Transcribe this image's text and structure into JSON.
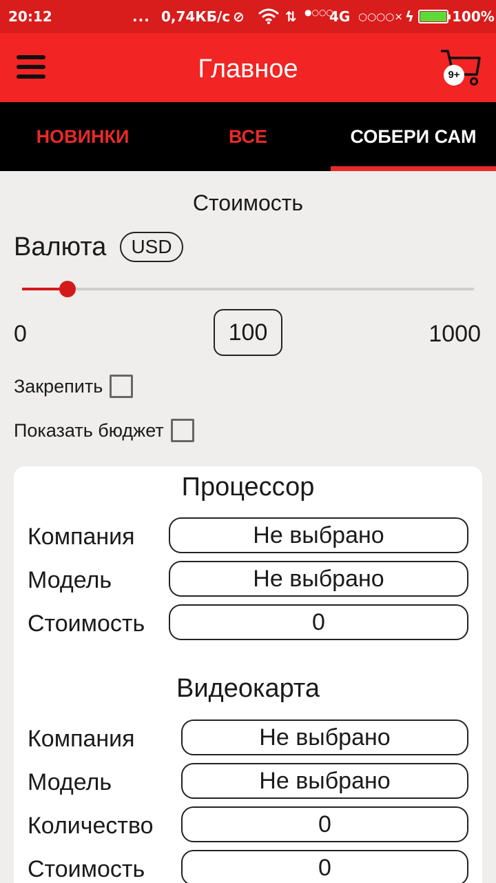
{
  "status_bar": {
    "time": "20:12",
    "dots": "...",
    "speed": "0,74КБ/с",
    "network": "4G",
    "battery": "100%",
    "battery_level": 1.0,
    "icons": [
      "alarm-off-icon",
      "wifi-icon",
      "data-arrows-icon",
      "signal-icon",
      "charging-icon",
      "battery-icon"
    ]
  },
  "app_bar": {
    "title": "Главное",
    "cart_badge": "9+",
    "icons": [
      "menu-icon",
      "cart-icon"
    ]
  },
  "tabs": [
    {
      "label": "НОВИНКИ",
      "active": false
    },
    {
      "label": "ВСЕ",
      "active": false
    },
    {
      "label": "СОБЕРИ САМ",
      "active": true
    }
  ],
  "cost": {
    "title": "Стоимость",
    "currency_label": "Валюта",
    "currency": "USD",
    "min": "0",
    "max": "1000",
    "value": "100",
    "slider_fraction": 0.1,
    "pin_label": "Закрепить",
    "pin_checked": false,
    "show_budget_label": "Показать бюджет",
    "show_budget_checked": false
  },
  "processor": {
    "title": "Процессор",
    "company_label": "Компания",
    "company_value": "Не выбрано",
    "model_label": "Модель",
    "model_value": "Не выбрано",
    "cost_label": "Стоимость",
    "cost_value": "0"
  },
  "gpu": {
    "title": "Видеокарта",
    "company_label": "Компания",
    "company_value": "Не выбрано",
    "model_label": "Модель",
    "model_value": "Не выбрано",
    "quantity_label": "Количество",
    "quantity_value": "0",
    "cost_label": "Стоимость",
    "cost_value": "0"
  },
  "colors": {
    "status_bar": "#d91c1c",
    "app_bar": "#f22424",
    "tab_bar": "#000000",
    "accent": "#e82a2a",
    "background": "#efeeec"
  }
}
